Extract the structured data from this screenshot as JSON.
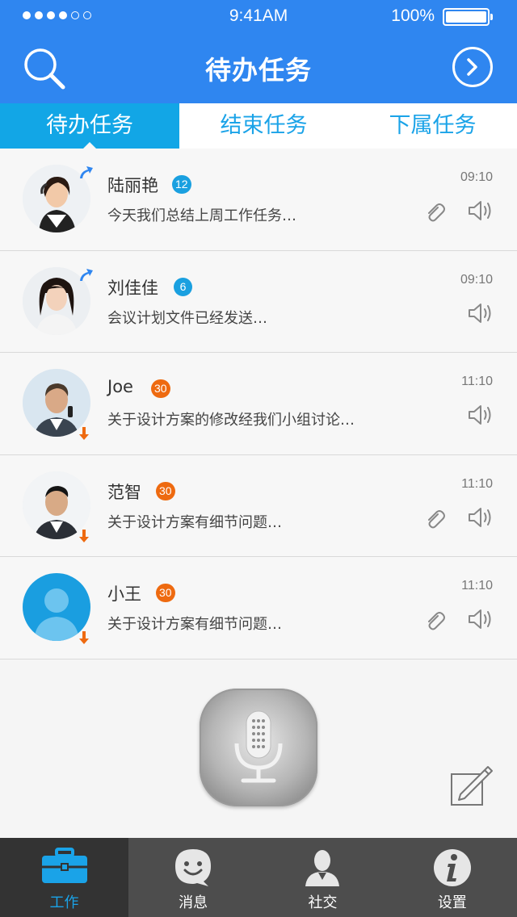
{
  "status_bar": {
    "time": "9:41AM",
    "battery": "100%"
  },
  "nav": {
    "title": "待办任务"
  },
  "tabs": [
    {
      "label": "待办任务",
      "active": true
    },
    {
      "label": "结束任务",
      "active": false
    },
    {
      "label": "下属任务",
      "active": false
    }
  ],
  "tasks": [
    {
      "name": "陆丽艳",
      "badge": "12",
      "badge_color": "#1aa0e0",
      "preview": "今天我们总结上周工作任务…",
      "time": "09:10",
      "attachment": true,
      "direction": "up"
    },
    {
      "name": "刘佳佳",
      "badge": "6",
      "badge_color": "#1aa0e0",
      "preview": "会议计划文件已经发送…",
      "time": "09:10",
      "attachment": false,
      "direction": "up"
    },
    {
      "name": "Joe",
      "badge": "30",
      "badge_color": "#ee6a10",
      "preview": "关于设计方案的修改经我们小组讨论…",
      "time": "11:10",
      "attachment": false,
      "direction": "down"
    },
    {
      "name": "范智",
      "badge": "30",
      "badge_color": "#ee6a10",
      "preview": "关于设计方案有细节问题…",
      "time": "11:10",
      "attachment": true,
      "direction": "down"
    },
    {
      "name": "小王",
      "badge": "30",
      "badge_color": "#ee6a10",
      "preview": "关于设计方案有细节问题…",
      "time": "11:10",
      "attachment": true,
      "direction": "down"
    }
  ],
  "tabbar": [
    {
      "label": "工作",
      "icon": "briefcase-icon",
      "active": true
    },
    {
      "label": "消息",
      "icon": "chat-smile-icon",
      "active": false
    },
    {
      "label": "社交",
      "icon": "contact-icon",
      "active": false
    },
    {
      "label": "设置",
      "icon": "info-icon",
      "active": false
    }
  ],
  "colors": {
    "primary": "#2f86f0",
    "tab_active": "#12a6e6",
    "badge_blue": "#1aa0e0",
    "badge_orange": "#ee6a10",
    "arrow_up": "#2f86f0",
    "arrow_down": "#ee6a10"
  }
}
